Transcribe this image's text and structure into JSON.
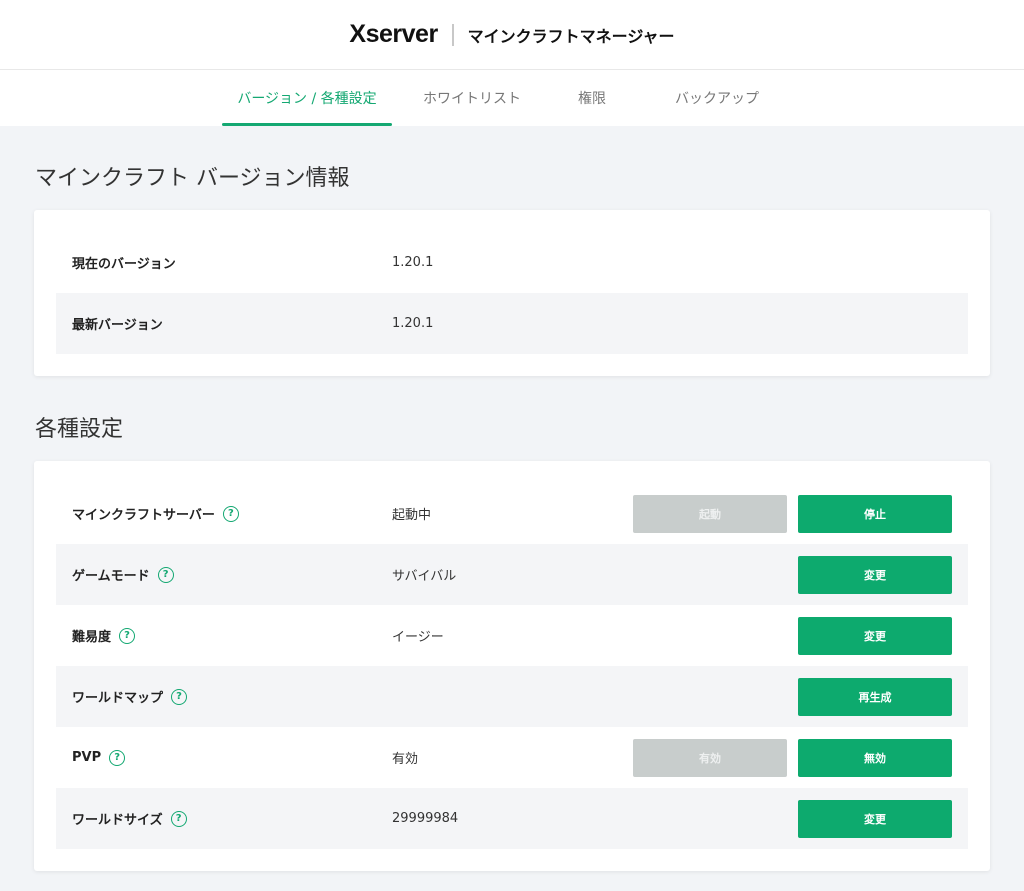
{
  "header": {
    "brand": "Xserver",
    "product": "マインクラフトマネージャー"
  },
  "tabs": [
    {
      "label": "バージョン / 各種設定",
      "active": true
    },
    {
      "label": "ホワイトリスト",
      "active": false
    },
    {
      "label": "権限",
      "active": false
    },
    {
      "label": "バックアップ",
      "active": false
    }
  ],
  "version_section": {
    "title": "マインクラフト バージョン情報",
    "rows": [
      {
        "label": "現在のバージョン",
        "value": "1.20.1"
      },
      {
        "label": "最新バージョン",
        "value": "1.20.1"
      }
    ]
  },
  "settings_section": {
    "title": "各種設定",
    "help_glyph": "?",
    "rows": [
      {
        "label": "マインクラフトサーバー",
        "value": "起動中",
        "buttons": [
          {
            "label": "起動",
            "disabled": true
          },
          {
            "label": "停止",
            "disabled": false
          }
        ]
      },
      {
        "label": "ゲームモード",
        "value": "サバイバル",
        "buttons": [
          {
            "label": "変更",
            "disabled": false
          }
        ]
      },
      {
        "label": "難易度",
        "value": "イージー",
        "buttons": [
          {
            "label": "変更",
            "disabled": false
          }
        ]
      },
      {
        "label": "ワールドマップ",
        "value": "",
        "buttons": [
          {
            "label": "再生成",
            "disabled": false
          }
        ]
      },
      {
        "label": "PVP",
        "value": "有効",
        "buttons": [
          {
            "label": "有効",
            "disabled": true
          },
          {
            "label": "無効",
            "disabled": false
          }
        ]
      },
      {
        "label": "ワールドサイズ",
        "value": "29999984",
        "buttons": [
          {
            "label": "変更",
            "disabled": false
          }
        ]
      }
    ]
  },
  "colors": {
    "accent": "#14a872",
    "button": "#0daa6e",
    "disabled": "#c8cdcc",
    "background": "#f2f4f7"
  }
}
